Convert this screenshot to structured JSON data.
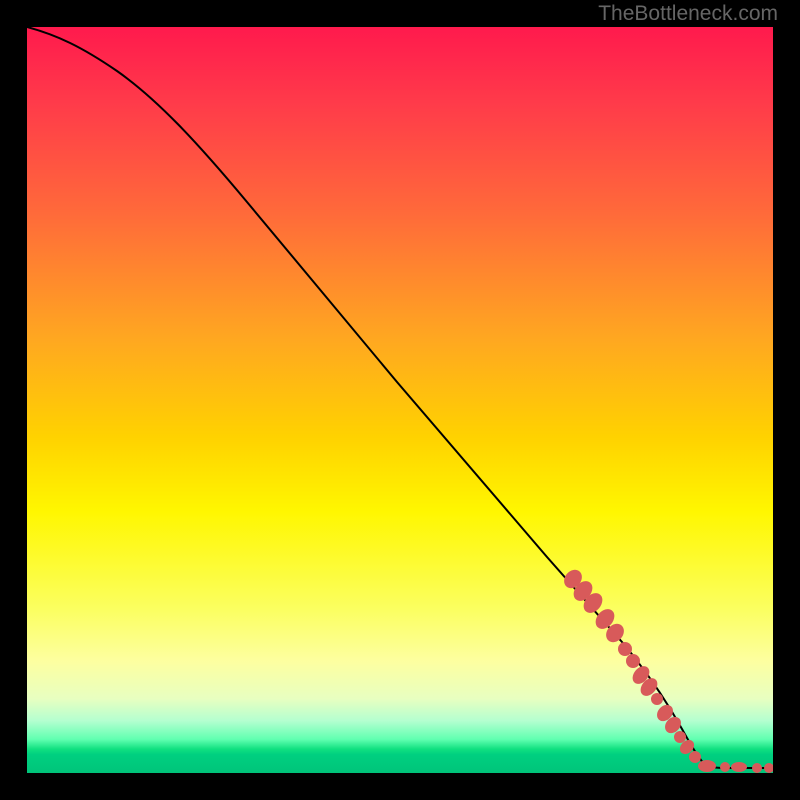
{
  "watermark": "TheBottleneck.com",
  "chart_data": {
    "type": "line",
    "title": "",
    "xlabel": "",
    "ylabel": "",
    "xlim": [
      0,
      100
    ],
    "ylim": [
      0,
      100
    ],
    "series": [
      {
        "name": "curve",
        "description": "Smooth decreasing curve from top-left origin, bends gently then descends near-linearly, flattening near x≈87 and running along the bottom to the right edge.",
        "x": [
          0,
          4,
          8,
          12,
          20,
          30,
          40,
          50,
          60,
          70,
          78,
          83,
          87,
          92,
          96,
          100
        ],
        "y": [
          100,
          99,
          97.5,
          95,
          88,
          77,
          65.5,
          54,
          42,
          30,
          19,
          11,
          3,
          1,
          0.6,
          0.6
        ]
      },
      {
        "name": "highlight-dots",
        "description": "Coral/salmon dots lying on the lower-right segment of the curve and along the bottom tail.",
        "x": [
          73,
          74,
          75,
          77,
          78.5,
          80,
          81.5,
          82.5,
          83.5,
          84.5,
          85.5,
          86.5,
          87.5,
          88.5,
          90.5,
          93,
          94,
          96.5,
          99,
          100
        ],
        "y": [
          26,
          24.5,
          23,
          20,
          18,
          16,
          13.5,
          12,
          10.5,
          9,
          7.5,
          6,
          4.5,
          3.5,
          1.2,
          0.9,
          0.8,
          0.7,
          0.6,
          0.6
        ]
      }
    ],
    "background_gradient": {
      "top": "#ff1a4d",
      "mid": "#ffe600",
      "bottom": "#00c47a"
    }
  }
}
